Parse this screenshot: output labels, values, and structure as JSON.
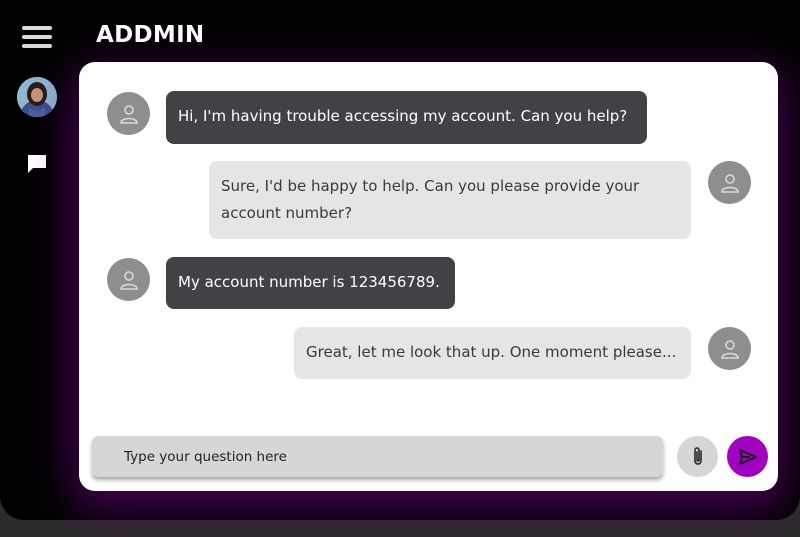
{
  "app": {
    "title": "ADDMIN"
  },
  "sidebar": {
    "menu_icon": "hamburger-menu-icon",
    "profile_icon": "user-profile-avatar",
    "chat_icon": "chat-bubble-icon"
  },
  "messages": [
    {
      "sender": "user",
      "text": "Hi, I'm having trouble accessing my account. Can you help?"
    },
    {
      "sender": "agent",
      "text": "Sure, I'd be happy to help. Can you please provide your account number?"
    },
    {
      "sender": "user",
      "text": "My account number is 123456789."
    },
    {
      "sender": "agent",
      "text": "Great, let me look that up. One moment please..."
    }
  ],
  "composer": {
    "placeholder": "Type your question here",
    "attach_icon": "paperclip-icon",
    "send_icon": "send-icon"
  },
  "colors": {
    "accent": "#a000c0",
    "user_bubble": "#434046",
    "agent_bubble": "#e5e5e5",
    "avatar": "#8e8e8e"
  }
}
